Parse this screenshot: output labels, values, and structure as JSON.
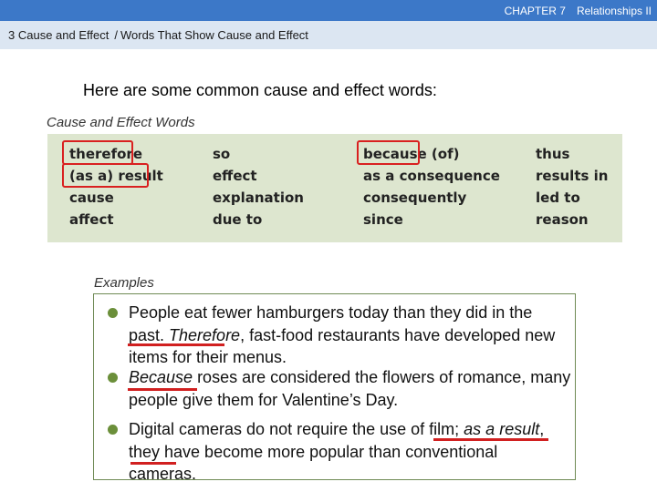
{
  "header": {
    "chapter": "CHAPTER 7",
    "section": "Relationships II"
  },
  "breadcrumb": {
    "part1": "3  Cause and Effect",
    "separator": "/",
    "part2": "Words That Show Cause and Effect"
  },
  "intro_text": "Here are some common cause and effect words:",
  "words_caption": "Cause and Effect Words",
  "word_columns": [
    [
      "therefore",
      "(as a) result",
      "cause",
      "affect"
    ],
    [
      "so",
      "effect",
      "explanation",
      "due to"
    ],
    [
      "because (of)",
      "as a consequence",
      "consequently",
      "since"
    ],
    [
      "thus",
      "results in",
      "led to",
      "reason"
    ]
  ],
  "examples_caption": "Examples",
  "examples": [
    {
      "pre": "People eat fewer hamburgers today than they did in the past. ",
      "emph": "Therefore",
      "post": ", fast-food restaurants have developed new items for their menus."
    },
    {
      "pre": "",
      "emph": "Because",
      "post": " roses are considered the flowers of romance, many people give them for Valentine’s Day."
    },
    {
      "pre": "Digital cameras do not require the use of film; ",
      "emph": "as a result",
      "post": ", they have become more popular than conventional cameras."
    }
  ],
  "colors": {
    "topbar": "#3c78c8",
    "breadcrumb_bg": "#dce6f2",
    "wordbox_bg": "#dde6cf",
    "highlight_red": "#d92020",
    "bullet_green": "#6b8f3a"
  }
}
